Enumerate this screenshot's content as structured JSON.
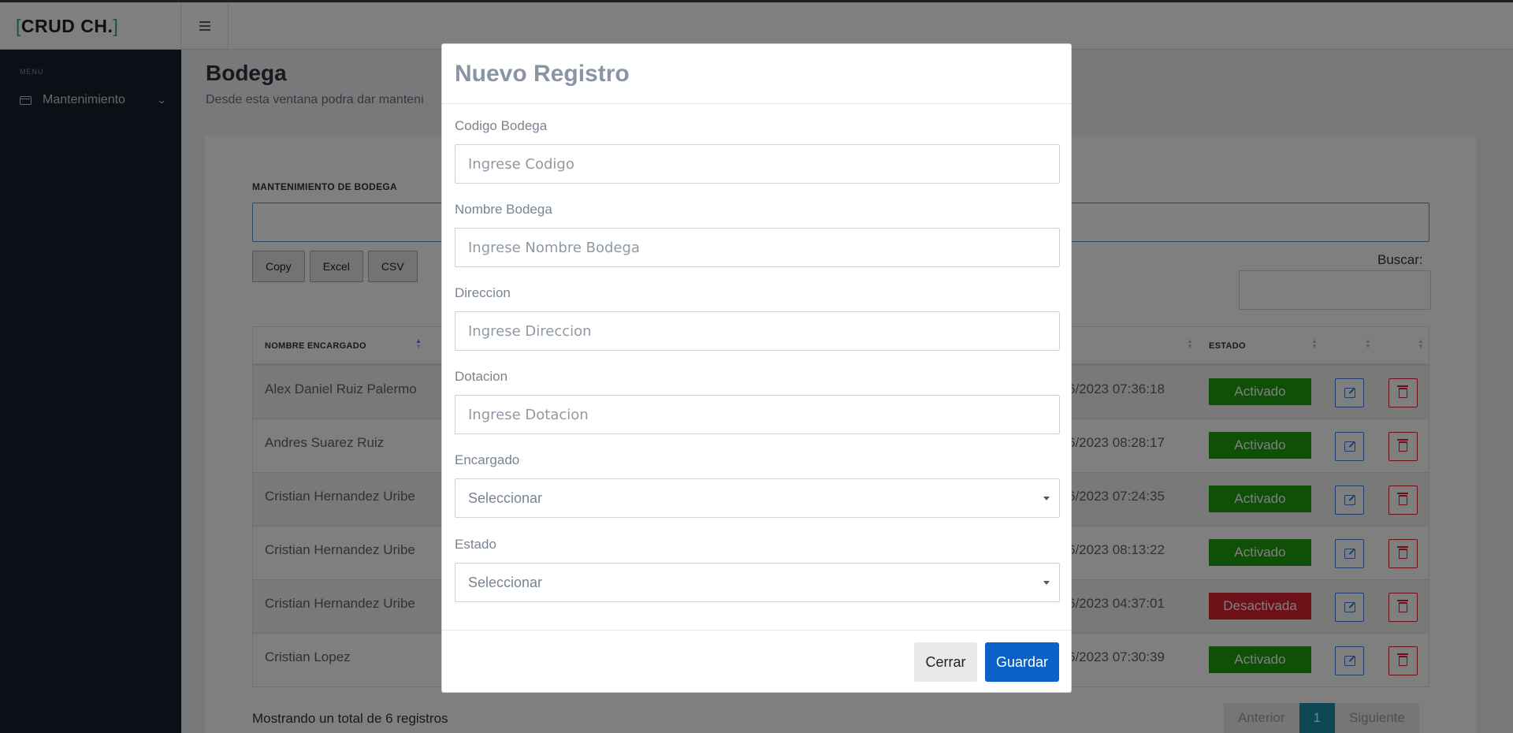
{
  "app": {
    "brand_name": "CRUD CH.",
    "bracket_open": "[",
    "bracket_close": "]"
  },
  "sidebar": {
    "section_label": "MENU",
    "items": [
      {
        "label": "Mantenimiento",
        "icon": "mail-icon"
      }
    ]
  },
  "page": {
    "title": "Bodega",
    "subtitle": "Desde esta ventana podra dar manteni"
  },
  "card": {
    "heading": "MANTENIMIENTO DE BODEGA",
    "export_buttons": [
      "Copy",
      "Excel",
      "CSV"
    ],
    "search_label": "Buscar:"
  },
  "table": {
    "columns": [
      "NOMBRE ENCARGADO",
      "ESTADO"
    ],
    "rows": [
      {
        "name": "Alex Daniel Ruiz Palermo",
        "date": "6/2023 07:36:18",
        "status": "Activado",
        "active": true
      },
      {
        "name": "Andres Suarez Ruiz",
        "date": "6/2023 08:28:17",
        "status": "Activado",
        "active": true
      },
      {
        "name": "Cristian Hernandez Uribe",
        "date": "6/2023 07:24:35",
        "status": "Activado",
        "active": true
      },
      {
        "name": "Cristian Hernandez Uribe",
        "date": "6/2023 08:13:22",
        "status": "Activado",
        "active": true
      },
      {
        "name": "Cristian Hernandez Uribe",
        "date": "6/2023 04:37:01",
        "status": "Desactivada",
        "active": false
      },
      {
        "name": "Cristian Lopez",
        "date": "6/2023 07:30:39",
        "status": "Activado",
        "active": true
      }
    ],
    "footer_info": "Mostrando un total de 6 registros"
  },
  "pagination": {
    "prev": "Anterior",
    "current": "1",
    "next": "Siguiente"
  },
  "modal": {
    "title": "Nuevo Registro",
    "fields": [
      {
        "label": "Codigo Bodega",
        "placeholder": "Ingrese Codigo"
      },
      {
        "label": "Nombre Bodega",
        "placeholder": "Ingrese Nombre Bodega"
      },
      {
        "label": "Direccion",
        "placeholder": "Ingrese Direccion"
      },
      {
        "label": "Dotacion",
        "placeholder": "Ingrese Dotacion"
      }
    ],
    "selects": [
      {
        "label": "Encargado",
        "value": "Seleccionar"
      },
      {
        "label": "Estado",
        "value": "Seleccionar"
      }
    ],
    "close_label": "Cerrar",
    "save_label": "Guardar"
  },
  "colors": {
    "sidebar_bg": "#18212c",
    "active_badge": "#1e9e0f",
    "inactive_badge": "#d8232f",
    "primary": "#0a61c7",
    "pager_active": "#1e8fa8"
  }
}
